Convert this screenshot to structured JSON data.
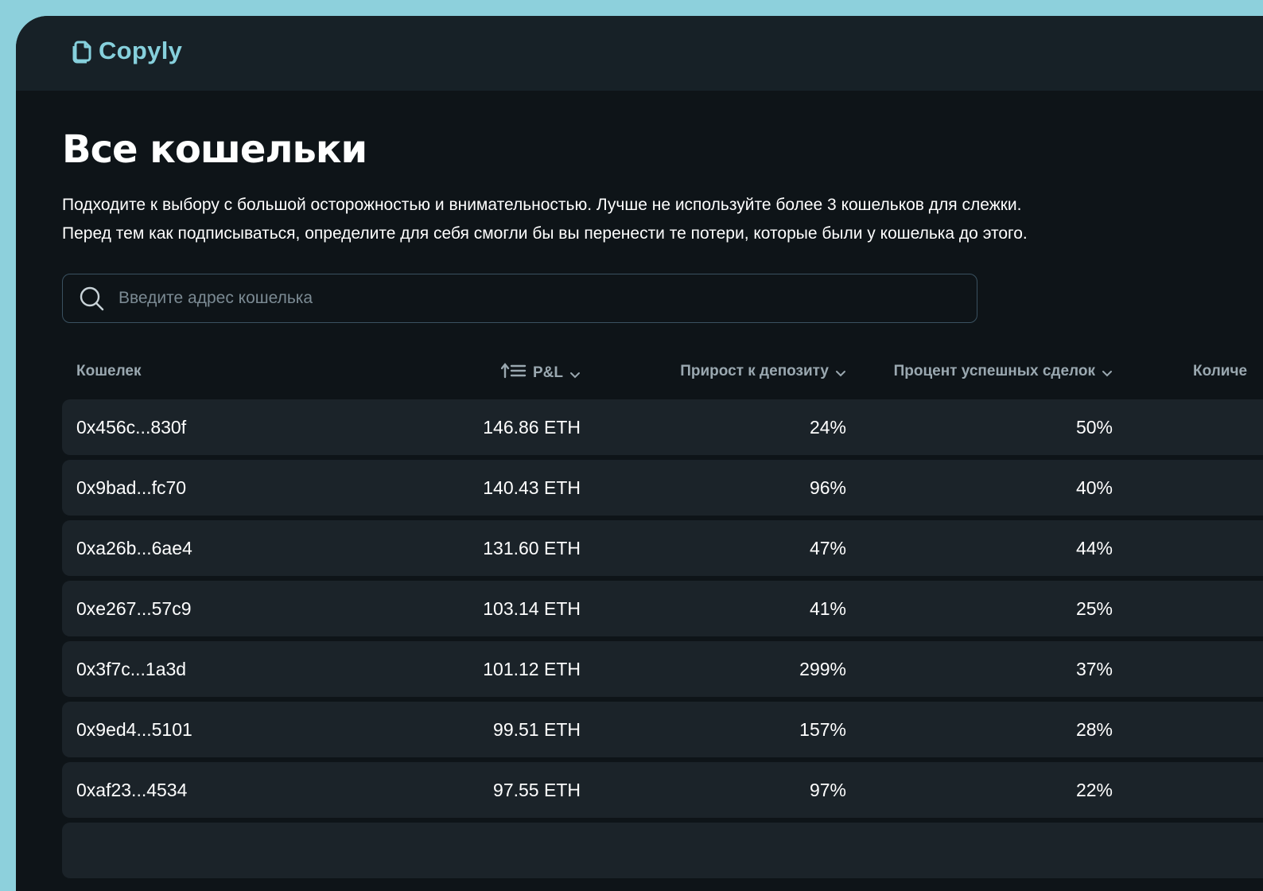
{
  "app": {
    "name": "Copyly"
  },
  "header": {
    "title": "Все кошельки",
    "description_line1": "Подходите к выбору с большой осторожностью и внимательностью. Лучше не используйте более 3 кошельков для слежки.",
    "description_line2": "Перед тем как подписываться, определите для себя смогли бы вы перенести те потери, которые были у кошелька до этого."
  },
  "search": {
    "placeholder": "Введите адрес кошелька",
    "value": ""
  },
  "table": {
    "columns": {
      "wallet": "Кошелек",
      "pnl": "P&L",
      "growth": "Прирост к депозиту",
      "success": "Процент успешных сделок",
      "count": "Количе"
    },
    "rows": [
      {
        "wallet": "0x456c...830f",
        "pnl": "146.86 ETH",
        "growth": "24%",
        "success": "50%"
      },
      {
        "wallet": "0x9bad...fc70",
        "pnl": "140.43 ETH",
        "growth": "96%",
        "success": "40%"
      },
      {
        "wallet": "0xa26b...6ae4",
        "pnl": "131.60 ETH",
        "growth": "47%",
        "success": "44%"
      },
      {
        "wallet": "0xe267...57c9",
        "pnl": "103.14 ETH",
        "growth": "41%",
        "success": "25%"
      },
      {
        "wallet": "0x3f7c...1a3d",
        "pnl": "101.12 ETH",
        "growth": "299%",
        "success": "37%"
      },
      {
        "wallet": "0x9ed4...5101",
        "pnl": "99.51 ETH",
        "growth": "157%",
        "success": "28%"
      },
      {
        "wallet": "0xaf23...4534",
        "pnl": "97.55 ETH",
        "growth": "97%",
        "success": "22%"
      },
      {
        "wallet": "",
        "pnl": "",
        "growth": "",
        "success": ""
      }
    ]
  },
  "colors": {
    "accent": "#86d0dc",
    "background": "#0e1418",
    "topbar": "#172127",
    "row": "#1b2329",
    "muted_text": "#9aa8b0"
  },
  "icons": {
    "logo": "copy-documents-icon",
    "search": "search-icon",
    "sort": "sort-ascending-icon",
    "chevron": "chevron-down-icon"
  }
}
